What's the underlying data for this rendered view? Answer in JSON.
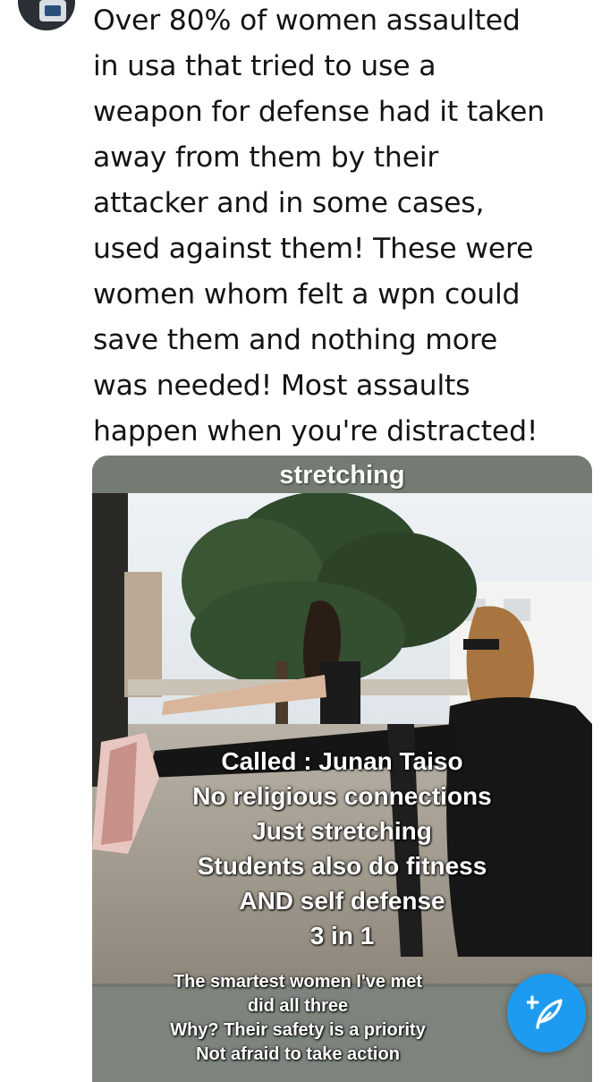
{
  "tweet": {
    "lines": [
      "Over 80% of women assaulted",
      "in usa that tried to use a",
      "weapon for defense had it taken",
      "away from them by their",
      "attacker and in some cases,",
      "used against them! These were",
      "women whom felt a wpn could",
      "save them and nothing more",
      "was needed! Most assaults",
      "happen when you're distracted!"
    ]
  },
  "media": {
    "top_label": "stretching",
    "caption_lines": [
      "Called : Junan Taiso",
      "No religious connections",
      "Just stretching",
      "Students also do fitness",
      "AND self defense",
      "3 in 1"
    ],
    "bottom_lines": [
      "The smartest women I've met",
      "did all three",
      "Why? Their safety is a priority",
      "Not afraid to take action"
    ]
  },
  "compose_button": {
    "icon": "feather-plus-icon",
    "color": "#1d9bf0"
  }
}
